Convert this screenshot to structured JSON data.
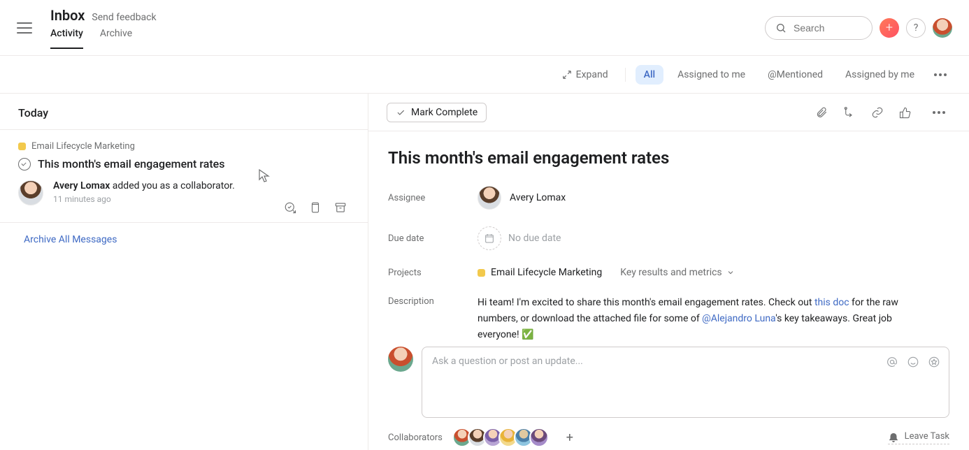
{
  "header": {
    "title": "Inbox",
    "feedback": "Send feedback",
    "tabs": {
      "activity": "Activity",
      "archive": "Archive"
    },
    "search_placeholder": "Search",
    "help_label": "?"
  },
  "filters": {
    "expand": "Expand",
    "all": "All",
    "assigned_to_me": "Assigned to me",
    "mentioned": "@Mentioned",
    "assigned_by_me": "Assigned by me"
  },
  "inbox": {
    "today": "Today",
    "item": {
      "project": "Email Lifecycle Marketing",
      "title": "This month's email engagement rates",
      "actor": "Avery Lomax",
      "action": " added you as a collaborator.",
      "time": "11 minutes ago"
    },
    "archive_all": "Archive All Messages"
  },
  "task": {
    "mark_complete": "Mark Complete",
    "title": "This month's email engagement rates",
    "labels": {
      "assignee": "Assignee",
      "due_date": "Due date",
      "projects": "Projects",
      "description": "Description"
    },
    "assignee": "Avery Lomax",
    "due_date": "No due date",
    "project": "Email Lifecycle Marketing",
    "section": "Key results and metrics",
    "description": {
      "part1": "Hi team! I'm excited to share this month's email engagement rates. Check out ",
      "doc_link": "this doc",
      "part2": " for the raw numbers, or download the attached file for some of ",
      "mention": "@Alejandro Luna",
      "part3": "'s key takeaways. Great job everyone!  ✅"
    },
    "comment_placeholder": "Ask a question or post an update...",
    "collaborators_label": "Collaborators",
    "leave_task": "Leave Task"
  }
}
